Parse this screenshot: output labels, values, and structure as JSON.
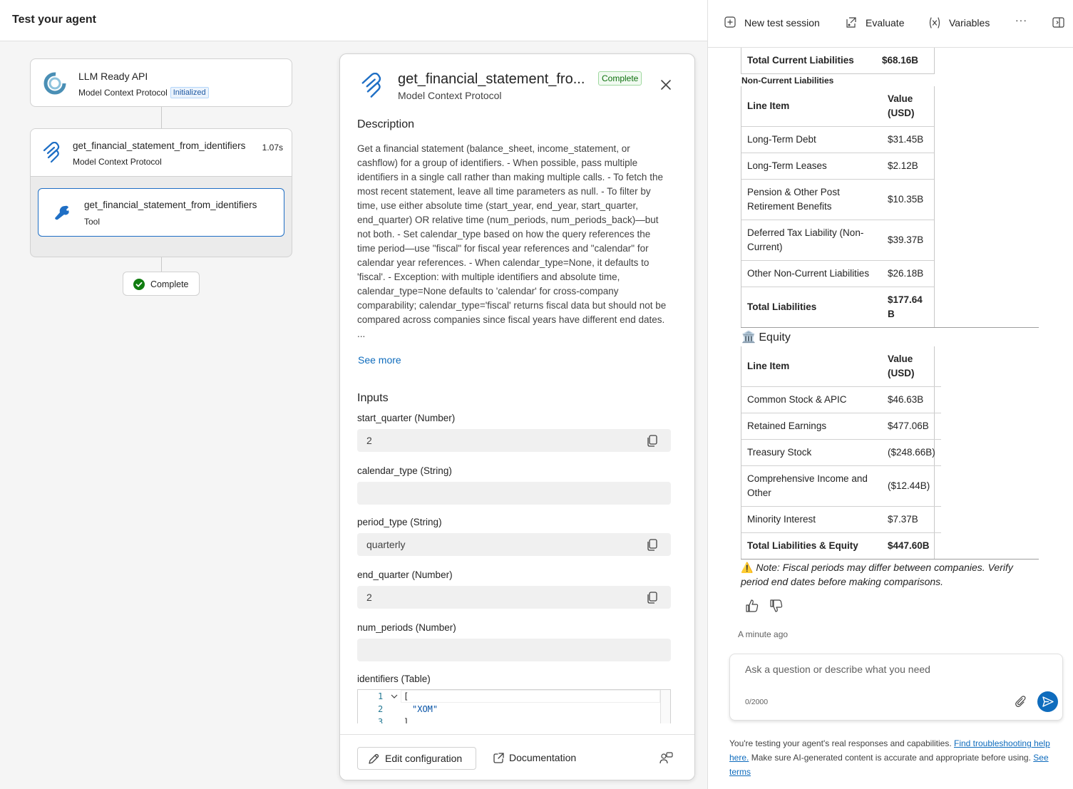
{
  "header": {
    "title": "Test your agent"
  },
  "toolbar": {
    "new_session": "New test session",
    "evaluate": "Evaluate",
    "variables": "Variables",
    "more": "···"
  },
  "flow": {
    "llm": {
      "name": "LLM Ready API",
      "sub": "Model Context Protocol",
      "badge": "Initialized"
    },
    "step": {
      "name": "get_financial_statement_from_identifiers",
      "duration": "1.07s",
      "sub": "Model Context Protocol"
    },
    "tool": {
      "name": "get_financial_statement_from_identifiers",
      "sub": "Tool"
    },
    "status": "Complete"
  },
  "panel": {
    "title": "get_financial_statement_fro...",
    "status_badge": "Complete",
    "subtitle": "Model Context Protocol",
    "description_heading": "Description",
    "description": "Get a financial statement (balance_sheet, income_statement, or cashflow) for a group of identifiers. - When possible, pass multiple identifiers in a single call rather than making multiple calls. - To fetch the most recent statement, leave all time parameters as null. - To filter by time, use either absolute time (start_year, end_year, start_quarter, end_quarter) OR relative time (num_periods, num_periods_back)—but not both. - Set calendar_type based on how the query references the time period—use \"fiscal\" for fiscal year references and \"calendar\" for calendar year references. - When calendar_type=None, it defaults to 'fiscal'. - Exception: with multiple identifiers and absolute time, calendar_type=None defaults to 'calendar' for cross-company comparability; calendar_type='fiscal' returns fiscal data but should not be compared across companies since fiscal years have different end dates. ...",
    "see_more": "See more",
    "inputs_heading": "Inputs",
    "inputs": [
      {
        "label": "start_quarter (Number)",
        "value": "2"
      },
      {
        "label": "calendar_type (String)",
        "value": ""
      },
      {
        "label": "period_type (String)",
        "value": "quarterly"
      },
      {
        "label": "end_quarter (Number)",
        "value": "2"
      },
      {
        "label": "num_periods (Number)",
        "value": ""
      },
      {
        "label": "identifiers (Table)",
        "value": ""
      }
    ],
    "code": {
      "line_numbers": [
        "1",
        "2",
        "3"
      ],
      "lines": [
        "[",
        "\"XOM\"",
        "]"
      ]
    },
    "edit_button": "Edit configuration",
    "doc_button": "Documentation"
  },
  "chat": {
    "total_current_liabilities": {
      "label": "Total Current Liabilities",
      "value": "$68.16B"
    },
    "noncurrent_heading": "Non-Current Liabilities",
    "header_line_item": "Line Item",
    "header_value": "Value (USD)",
    "noncurrent_rows": [
      {
        "item": "Long-Term Debt",
        "value": "$31.45B"
      },
      {
        "item": "Long-Term Leases",
        "value": "$2.12B"
      },
      {
        "item": "Pension & Other Post Retirement Benefits",
        "value": "$10.35B"
      },
      {
        "item": "Deferred Tax Liability (Non-Current)",
        "value": "$39.37B"
      },
      {
        "item": "Other Non-Current Liabilities",
        "value": "$26.18B"
      },
      {
        "item": "Total Liabilities",
        "value": "$177.64 B"
      }
    ],
    "equity_icon": "🏛️",
    "equity_heading": "Equity",
    "equity_rows": [
      {
        "item": "Common Stock & APIC",
        "value": "$46.63B"
      },
      {
        "item": "Retained Earnings",
        "value": "$477.06B"
      },
      {
        "item": "Treasury Stock",
        "value": "($248.66B)"
      },
      {
        "item": "Comprehensive Income and Other",
        "value": "($12.44B)"
      },
      {
        "item": "Minority Interest",
        "value": "$7.37B"
      },
      {
        "item": "Total Liabilities & Equity",
        "value": "$447.60B"
      }
    ],
    "note_icon": "⚠️",
    "note": "Note: Fiscal periods may differ between companies. Verify period end dates before making comparisons.",
    "timestamp": "A minute ago",
    "input_placeholder": "Ask a question or describe what you need",
    "char_count": "0/2000",
    "disclaimer_1": "You're testing your agent's real responses and capabilities. ",
    "disclaimer_link_1": "Find troubleshooting help here.",
    "disclaimer_2": " Make sure AI-generated content is accurate and appropriate before using. ",
    "disclaimer_link_2": "See terms"
  },
  "colors": {
    "accent": "#0f6cbd",
    "success": "#107c10",
    "pane_bg": "#f5f5f5"
  }
}
